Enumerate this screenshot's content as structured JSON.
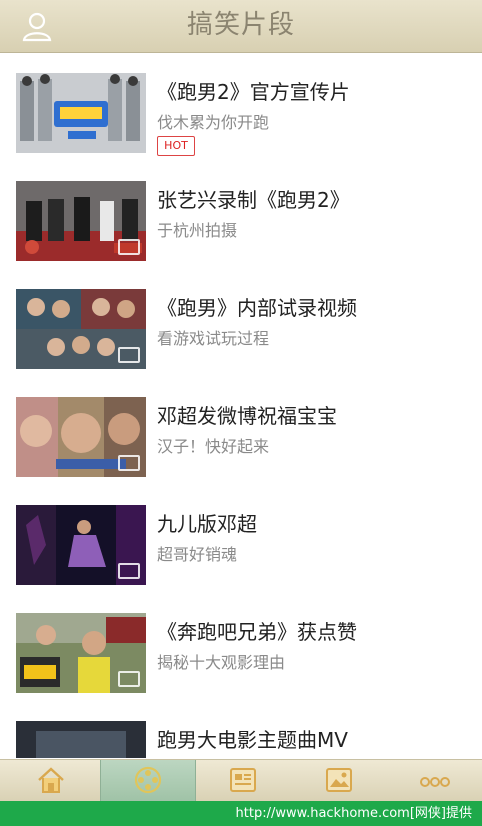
{
  "header": {
    "title": "搞笑片段",
    "left_icon": "user-icon"
  },
  "hot_badge": "HOT",
  "items": [
    {
      "title": "《跑男2》官方宣传片",
      "subtitle": "伐木累为你开跑",
      "badge": "HOT"
    },
    {
      "title": "张艺兴录制《跑男2》",
      "subtitle": "于杭州拍摄"
    },
    {
      "title": "《跑男》内部试录视频",
      "subtitle": "看游戏试玩过程"
    },
    {
      "title": "邓超发微博祝福宝宝",
      "subtitle": "汉子！快好起来"
    },
    {
      "title": "九儿版邓超",
      "subtitle": "超哥好销魂"
    },
    {
      "title": "《奔跑吧兄弟》获点赞",
      "subtitle": "揭秘十大观影理由"
    },
    {
      "title": "跑男大电影主题曲MV",
      "subtitle": ""
    }
  ],
  "tabs": [
    {
      "icon": "home-icon",
      "label": ""
    },
    {
      "icon": "film-reel-icon",
      "label": "",
      "active": true
    },
    {
      "icon": "news-icon",
      "label": ""
    },
    {
      "icon": "picture-icon",
      "label": ""
    },
    {
      "icon": "more-icon",
      "label": ""
    }
  ],
  "watermark": "http://www.hackhome.com[网侠]提供",
  "colors": {
    "header": "#ddd5b8",
    "tab_active": "#a9c8af",
    "hot": "#d22222",
    "watermark_bg": "#1ea94a"
  }
}
